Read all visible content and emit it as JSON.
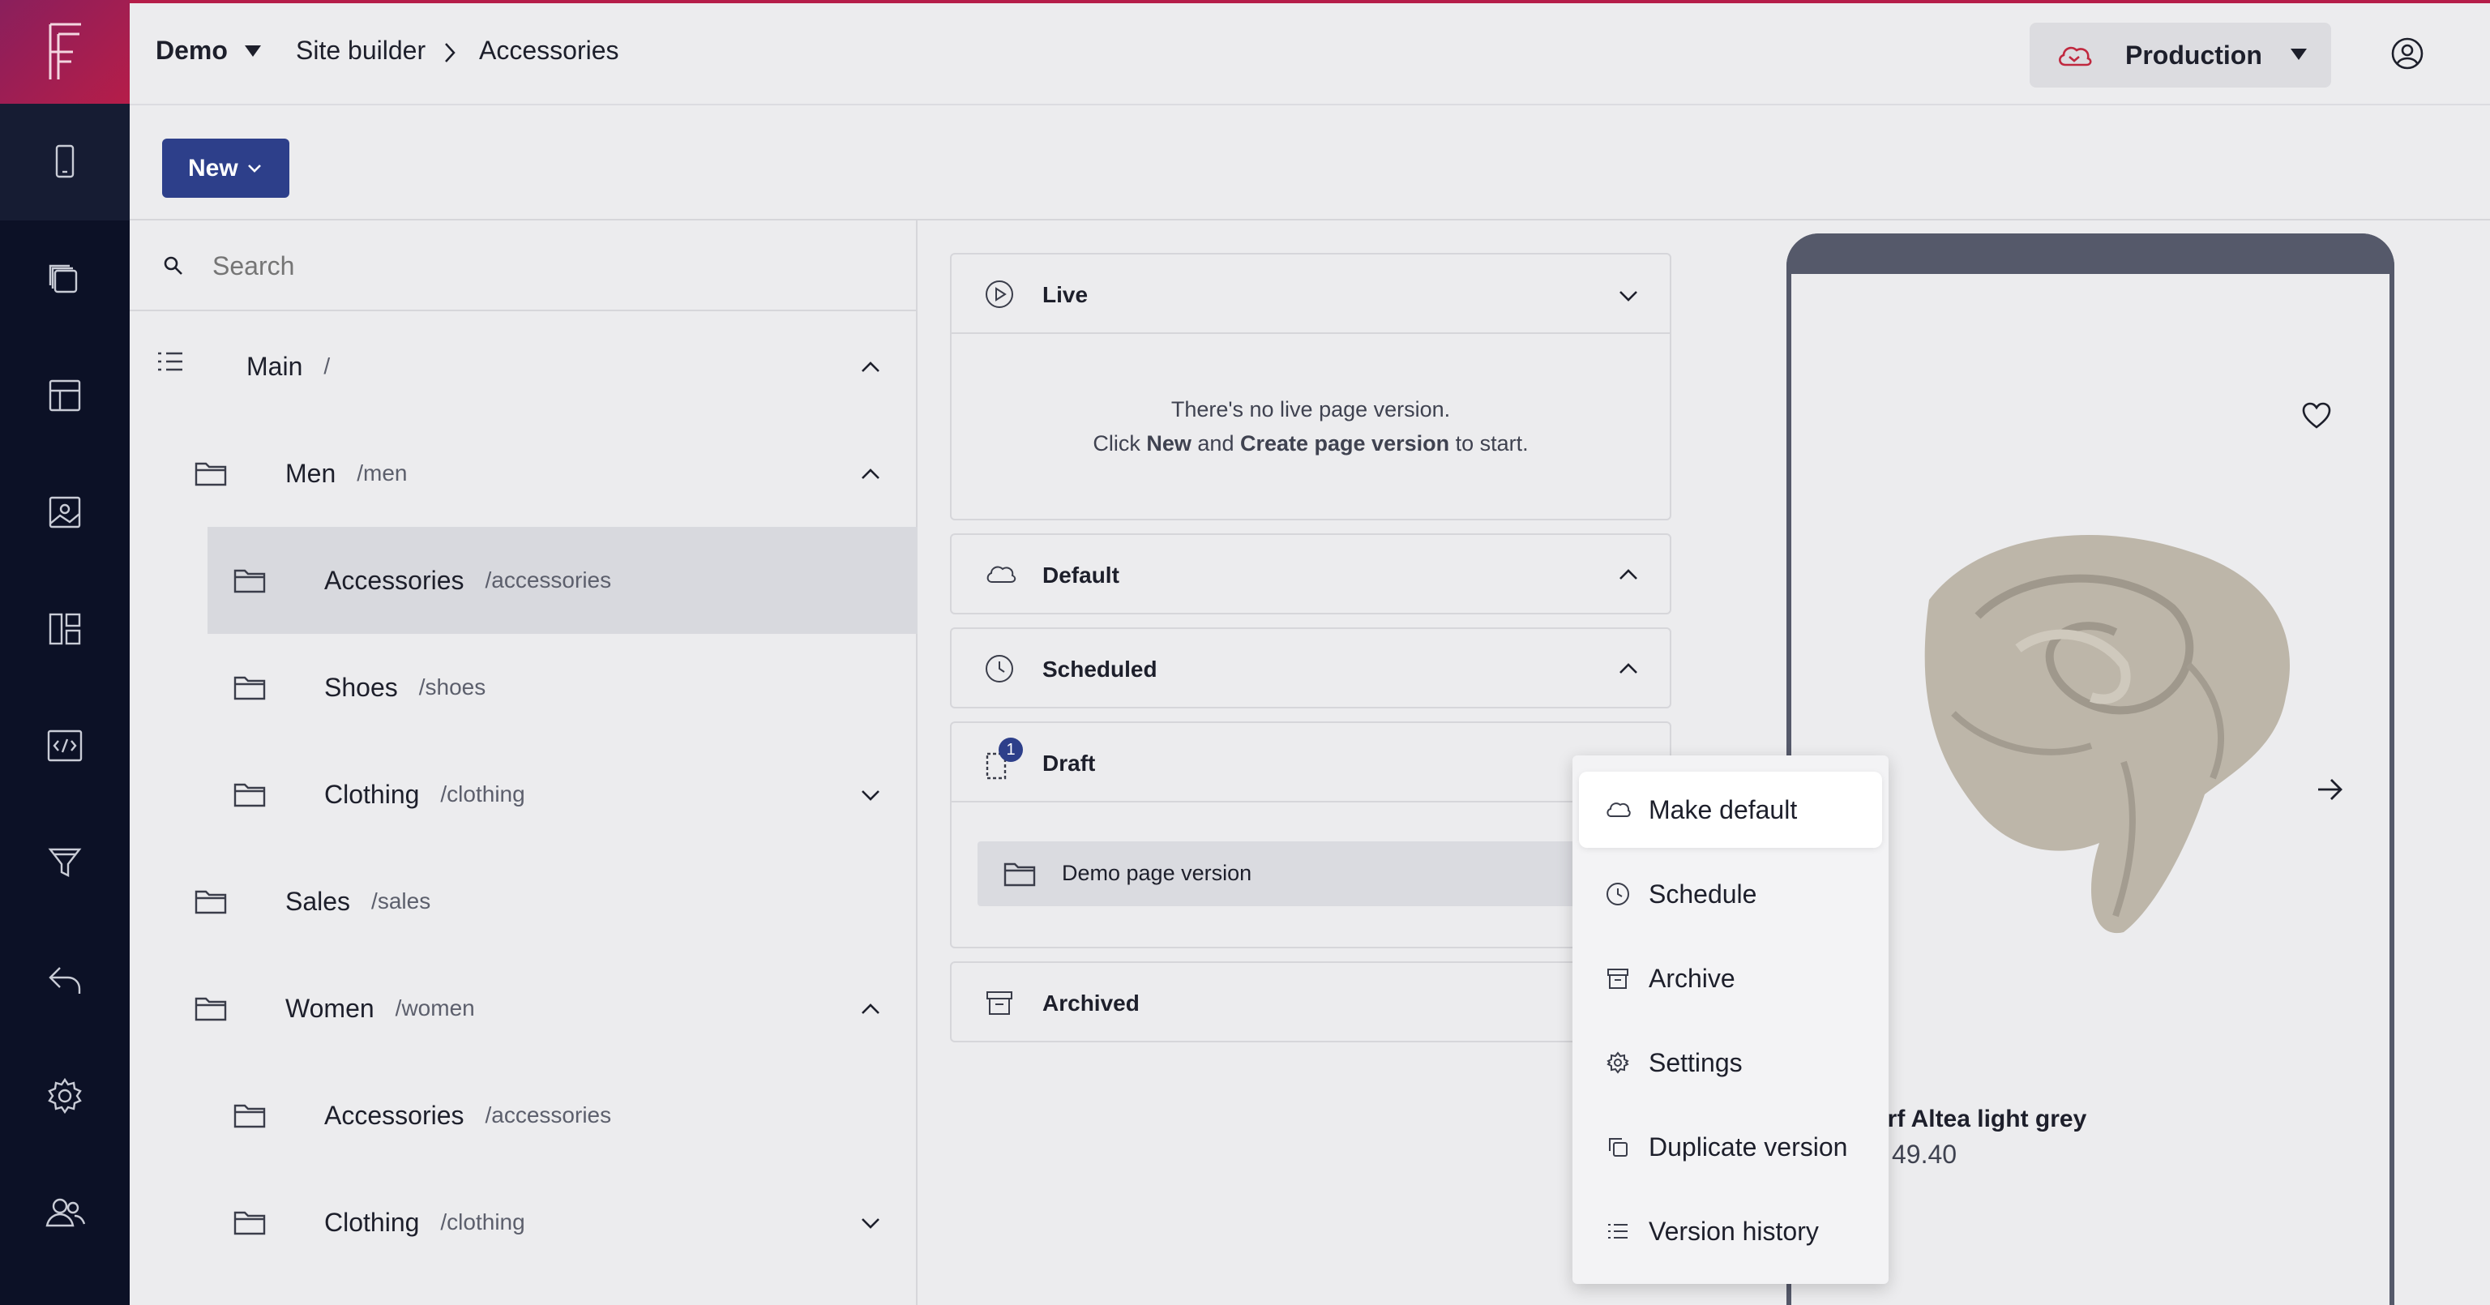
{
  "header": {
    "workspace": "Demo",
    "breadcrumb": [
      "Site builder",
      "Accessories"
    ],
    "environment": "Production"
  },
  "toolbar": {
    "new_label": "New"
  },
  "search": {
    "placeholder": "Search"
  },
  "tree": [
    {
      "name": "Main",
      "path": "/"
    },
    {
      "name": "Men",
      "path": "/men"
    },
    {
      "name": "Accessories",
      "path": "/accessories"
    },
    {
      "name": "Shoes",
      "path": "/shoes"
    },
    {
      "name": "Clothing",
      "path": "/clothing"
    },
    {
      "name": "Sales",
      "path": "/sales"
    },
    {
      "name": "Women",
      "path": "/women"
    },
    {
      "name": "Accessories",
      "path": "/accessories"
    },
    {
      "name": "Clothing",
      "path": "/clothing"
    }
  ],
  "versions": {
    "live": {
      "title": "Live",
      "empty_line1": "There's no live page version.",
      "empty_click": "Click",
      "empty_new": "New",
      "empty_and": "and",
      "empty_create": "Create page version",
      "empty_to_start": "to start."
    },
    "default": {
      "title": "Default"
    },
    "scheduled": {
      "title": "Scheduled"
    },
    "draft": {
      "title": "Draft",
      "badge": "1",
      "item": "Demo page version"
    },
    "archived": {
      "title": "Archived"
    }
  },
  "preview": {
    "product_name": "arf Altea light grey",
    "price": "49.40"
  },
  "menu": {
    "items": [
      "Make default",
      "Schedule",
      "Archive",
      "Settings",
      "Duplicate version",
      "Version history"
    ]
  }
}
